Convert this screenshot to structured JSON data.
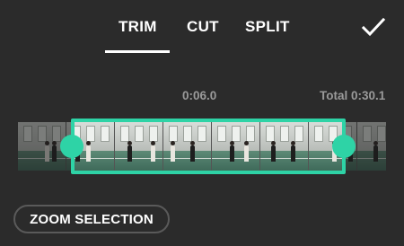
{
  "tabs": [
    {
      "label": "TRIM",
      "active": true
    },
    {
      "label": "CUT",
      "active": false
    },
    {
      "label": "SPLIT",
      "active": false
    }
  ],
  "confirm_icon": "checkmark-icon",
  "timeline": {
    "current_time": "0:06.0",
    "total_label": "Total 0:30.1",
    "accent_color": "#2ed3a6",
    "selection_start_fraction": 0.15,
    "selection_end_fraction": 0.89
  },
  "zoom_button": {
    "label": "ZOOM SELECTION"
  }
}
